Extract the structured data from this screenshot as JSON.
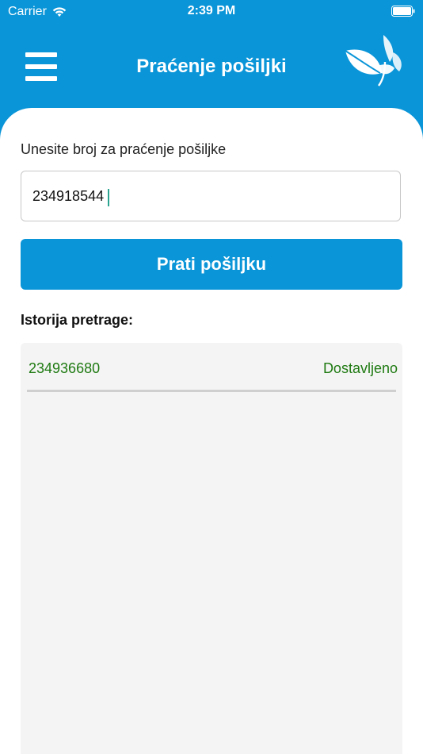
{
  "status_bar": {
    "carrier": "Carrier",
    "time": "2:39 PM",
    "icons": [
      "wifi-icon",
      "battery-icon"
    ]
  },
  "header": {
    "title": "Praćenje pošiljki",
    "icons": [
      "menu-icon",
      "leaf-logo-icon"
    ]
  },
  "form": {
    "label": "Unesite broj za praćenje pošiljke",
    "tracking_value": "234918544",
    "button_label": "Prati pošiljku"
  },
  "history": {
    "title": "Istorija pretrage:",
    "items": [
      {
        "number": "234936680",
        "status": "Dostavljeno"
      }
    ]
  },
  "colors": {
    "brand_blue": "#0a95d8",
    "history_text_green": "#1f7a12",
    "panel_gray": "#f4f4f4",
    "caret_teal": "#2aa390"
  }
}
